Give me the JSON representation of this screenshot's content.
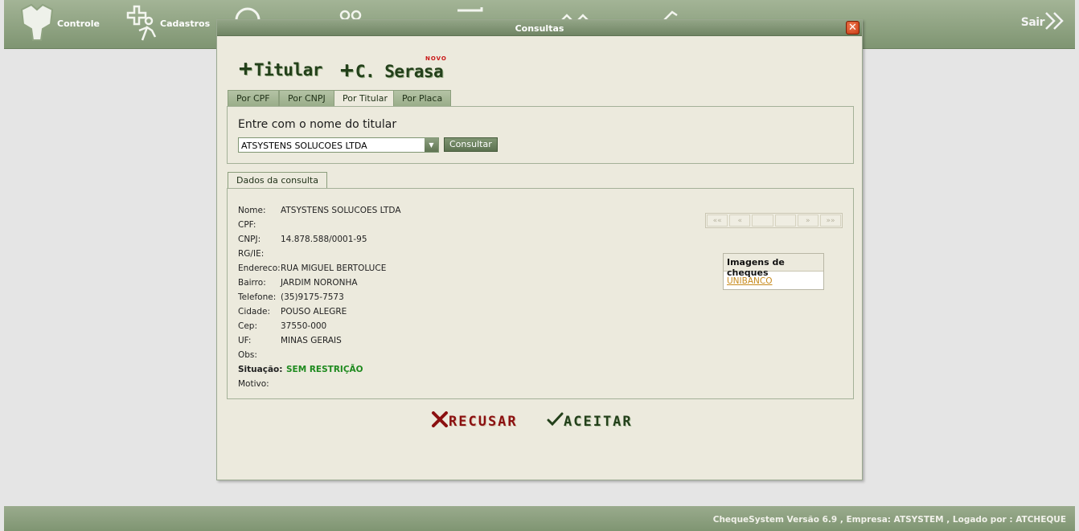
{
  "topbar": {
    "controle_label": "Controle",
    "cadastros_label": "Cadastros",
    "sair_label": "Sair"
  },
  "modal": {
    "title": "Consultas",
    "add_titular_label": "Titular",
    "add_serasa_label": "C. Serasa",
    "novo_badge": "NOVO",
    "tabs": [
      {
        "label": "Por CPF"
      },
      {
        "label": "Por CNPJ"
      },
      {
        "label": "Por Titular"
      },
      {
        "label": "Por Placa"
      }
    ],
    "search": {
      "label": "Entre com o nome do titular",
      "selected": "ATSYSTENS SOLUCOES LTDA",
      "button": "Consultar"
    },
    "details_tab": "Dados da consulta",
    "details": {
      "nome_label": "Nome:",
      "nome": "ATSYSTENS SOLUCOES LTDA",
      "cpf_label": "CPF:",
      "cpf": "",
      "cnpj_label": "CNPJ:",
      "cnpj": "14.878.588/0001-95",
      "rg_label": "RG/IE:",
      "rg": "",
      "endereco_label": "Endereco:",
      "endereco": "RUA MIGUEL BERTOLUCE",
      "bairro_label": "Bairro:",
      "bairro": "JARDIM NORONHA",
      "telefone_label": "Telefone:",
      "telefone": "(35)9175-7573",
      "cidade_label": "Cidade:",
      "cidade": "POUSO ALEGRE",
      "cep_label": "Cep:",
      "cep": "37550-000",
      "uf_label": "UF:",
      "uf": "MINAS GERAIS",
      "obs_label": "Obs:",
      "obs": "",
      "situacao_label": "Situação:",
      "situacao": "SEM RESTRIÇÃO",
      "motivo_label": "Motivo:",
      "motivo": ""
    },
    "pager": {
      "first": "««",
      "prev": "«",
      "next": "»",
      "last": "»»"
    },
    "imagens": {
      "title": "Imagens de cheques",
      "link": "UNIBANCO"
    },
    "recusar_label": "RECUSAR",
    "aceitar_label": "ACEITAR"
  },
  "footer": {
    "text": "ChequeSystem Versão 6.9 , Empresa: ATSYSTEM , Logado por : ATCHEQUE"
  },
  "colors": {
    "bar": "#7f9572",
    "modal_bg": "#eceadd",
    "situacao_ok": "#1e8a1e",
    "recusar": "#8b1010"
  }
}
